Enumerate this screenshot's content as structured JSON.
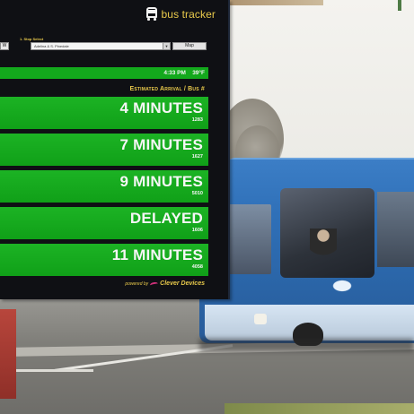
{
  "header": {
    "brand": "bus tracker",
    "bus_icon": "bus-icon"
  },
  "stop": {
    "label": "1. Stop Select",
    "prefix": "W",
    "selected": "Adelina & S. Pinedale",
    "map_button": "Map"
  },
  "status": {
    "time": "4:33 PM",
    "temp": "39°F"
  },
  "arrivals_header": "Estimated Arrival / Bus #",
  "arrivals": [
    {
      "status": "4 MINUTES",
      "bus": "1283"
    },
    {
      "status": "7 MINUTES",
      "bus": "1627"
    },
    {
      "status": "9 MINUTES",
      "bus": "5010"
    },
    {
      "status": "DELAYED",
      "bus": "1606"
    },
    {
      "status": "11 MINUTES",
      "bus": "4058"
    }
  ],
  "footer": {
    "powered_by": "powered by",
    "company": "Clever Devices"
  },
  "colors": {
    "panel": "#0f1014",
    "accent_yellow": "#e8c94b",
    "arrival_green": "#13a91c"
  }
}
